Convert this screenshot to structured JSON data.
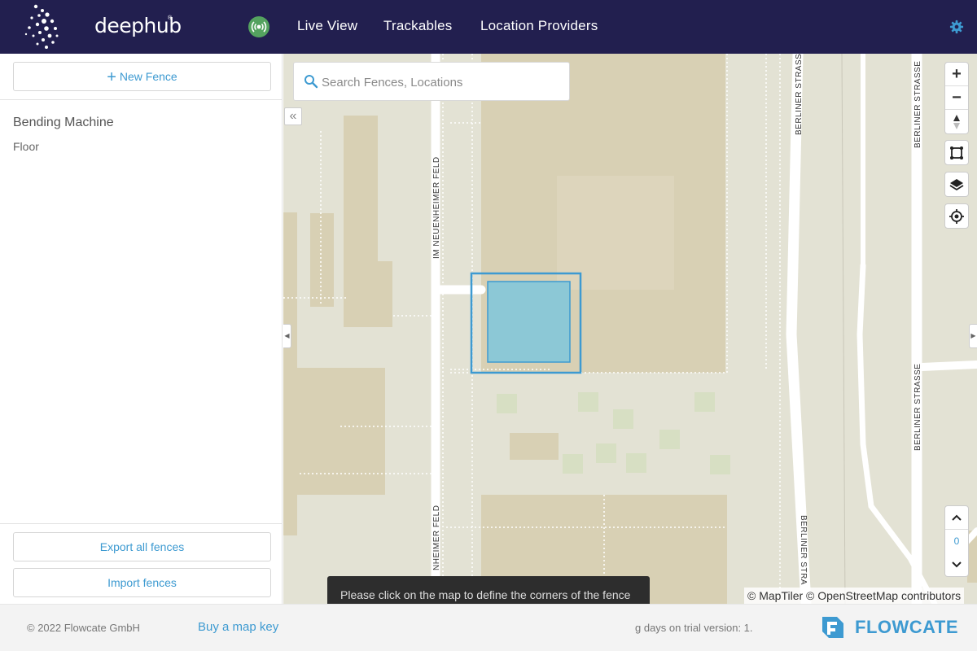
{
  "header": {
    "logo_text": "deephub",
    "logo_reg": "®",
    "nav": [
      "Live View",
      "Trackables",
      "Location Providers"
    ]
  },
  "sidebar": {
    "new_fence_label": "New Fence",
    "fences": [
      {
        "name": "Bending Machine",
        "type": "Floor"
      }
    ],
    "export_label": "Export all fences",
    "import_label": "Import fences"
  },
  "map": {
    "search_placeholder": "Search Fences, Locations",
    "street_labels": [
      "IM NEUENHEIMER FELD",
      "NHEIMER FELD",
      "BERLINER STRASSE",
      "BERLINER STRASSE",
      "BERLINER STRASSE",
      "BERLINER STRA"
    ],
    "floor_value": "0",
    "attribution": "© MapTiler © OpenStreetMap contributors",
    "tooltip": "Please click on the map to define the corners of the fence"
  },
  "footer": {
    "copyright": "© 2022 Flowcate GmbH",
    "buy_key": "Buy a map key",
    "trial_text": "g days on trial version: 1.",
    "brand": "FLOWCATE"
  },
  "colors": {
    "header_bg": "#221f4f",
    "accent": "#3d9ad1",
    "status_green": "#54a25f",
    "fence_fill": "#8cc8d6",
    "fence_stroke": "#3d9ad1"
  }
}
